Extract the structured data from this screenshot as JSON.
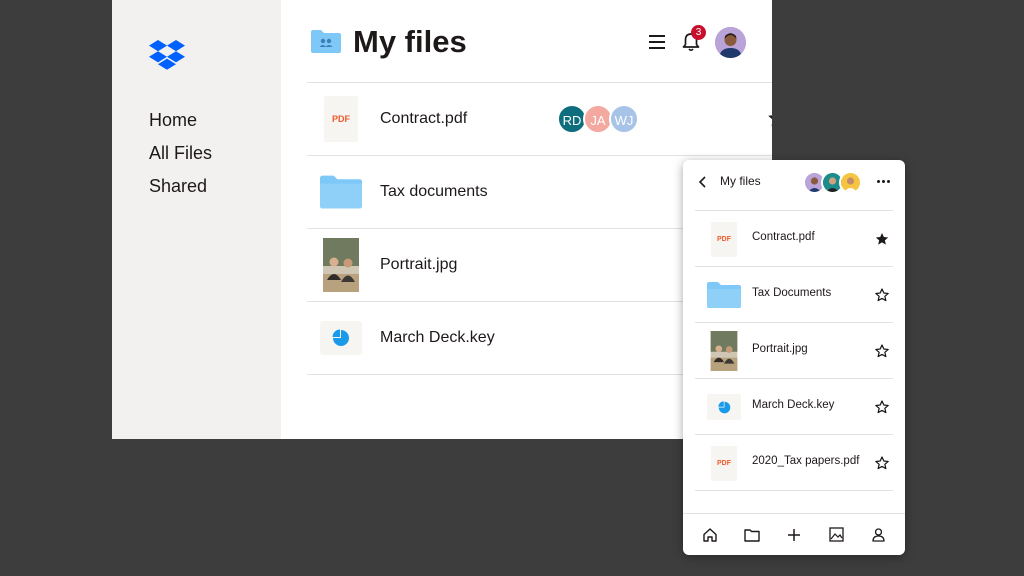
{
  "sidebar": {
    "items": [
      {
        "label": "Home"
      },
      {
        "label": "All Files"
      },
      {
        "label": "Shared"
      }
    ]
  },
  "header": {
    "title": "My files",
    "notification_count": "3"
  },
  "files": [
    {
      "name": "Contract.pdf",
      "type": "pdf",
      "type_label": "PDF",
      "starred": true,
      "collaborators": [
        {
          "initials": "RD",
          "color": "#0e6e7e"
        },
        {
          "initials": "JA",
          "color": "#f3a9a0"
        },
        {
          "initials": "WJ",
          "color": "#a7c3e8"
        }
      ]
    },
    {
      "name": "Tax documents",
      "type": "folder"
    },
    {
      "name": "Portrait.jpg",
      "type": "image"
    },
    {
      "name": "March Deck.key",
      "type": "keynote"
    }
  ],
  "mobile": {
    "title": "My files",
    "files": [
      {
        "name": "Contract.pdf",
        "type": "pdf",
        "type_label": "PDF",
        "starred": true
      },
      {
        "name": "Tax Documents",
        "type": "folder",
        "starred": false
      },
      {
        "name": "Portrait.jpg",
        "type": "image",
        "starred": false
      },
      {
        "name": "March Deck.key",
        "type": "keynote",
        "starred": false
      },
      {
        "name": "2020_Tax papers.pdf",
        "type": "pdf",
        "type_label": "PDF",
        "starred": false
      }
    ],
    "tabs": [
      "home-icon",
      "folder-icon",
      "plus-icon",
      "photos-icon",
      "account-icon"
    ]
  },
  "colors": {
    "brand": "#0061fe",
    "folder": "#7ec8f7",
    "pdf": "#ef5a2a",
    "badge": "#c8102e",
    "keynote": "#1a9bea"
  }
}
